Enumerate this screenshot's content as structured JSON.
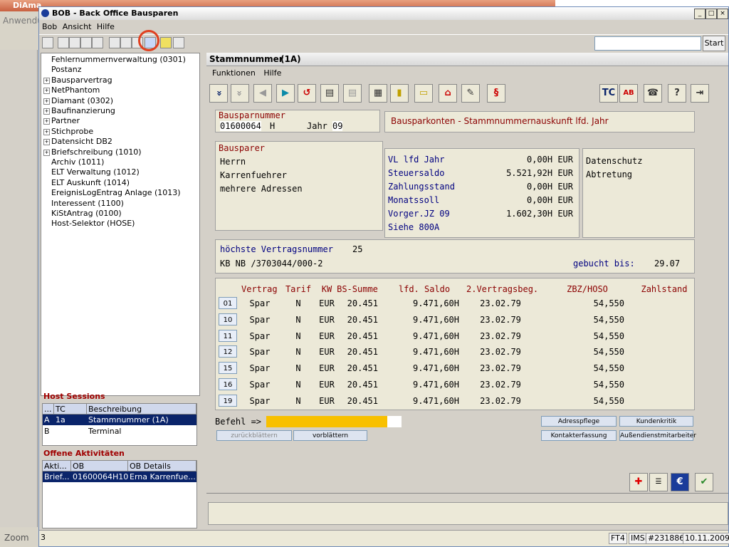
{
  "background_window": {
    "title": "DiAma",
    "menu_label": "Anwendu",
    "zoom_label": "Zoom"
  },
  "window": {
    "title": "BOB - Back Office Bausparen",
    "menu": [
      "Bob",
      "Ansicht",
      "Hilfe"
    ],
    "start_button": "Start",
    "search_value": ""
  },
  "tree": {
    "items": [
      {
        "label": "Fehlernummernverwaltung (0301)",
        "expandable": false
      },
      {
        "label": "Postanz",
        "expandable": false
      },
      {
        "label": "Bausparvertrag",
        "expandable": true
      },
      {
        "label": "NetPhantom",
        "expandable": true
      },
      {
        "label": "Diamant (0302)",
        "expandable": true
      },
      {
        "label": "Baufinanzierung",
        "expandable": true
      },
      {
        "label": "Partner",
        "expandable": true
      },
      {
        "label": "Stichprobe",
        "expandable": true
      },
      {
        "label": "Datensicht DB2",
        "expandable": true
      },
      {
        "label": "Briefschreibung (1010)",
        "expandable": true
      },
      {
        "label": "Archiv (1011)",
        "expandable": false
      },
      {
        "label": "ELT Verwaltung (1012)",
        "expandable": false
      },
      {
        "label": "ELT Auskunft (1014)",
        "expandable": false
      },
      {
        "label": "EreignisLogEntrag Anlage (1013)",
        "expandable": false
      },
      {
        "label": "Interessent (1100)",
        "expandable": false
      },
      {
        "label": "KiStAntrag (0100)",
        "expandable": false
      },
      {
        "label": "Host-Selektor (HOSE)",
        "expandable": false
      }
    ]
  },
  "host_sessions": {
    "title": "Host Sessions",
    "headers": [
      "...",
      "TC",
      "Beschreibung"
    ],
    "rows": [
      {
        "c0": "A",
        "c1": "1a",
        "c2": "Stammnummer     (1A)",
        "selected": true
      },
      {
        "c0": "B",
        "c1": "",
        "c2": "Terminal",
        "selected": false
      }
    ]
  },
  "open_activities": {
    "title": "Offene Aktivitäten",
    "headers": [
      "Akti...",
      "OB",
      "OB Details"
    ],
    "rows": [
      {
        "c0": "Brief...",
        "c1": "01600064H10",
        "c2": "Erna Karrenfue...",
        "selected": true
      }
    ]
  },
  "panel": {
    "title": "Stammnummer",
    "code": "(1A)",
    "menu": [
      "Funktionen",
      "Hilfe"
    ],
    "icons": [
      "double-chevron-down-icon",
      "double-chevron-up-icon",
      "arrow-left-icon",
      "arrow-right-icon",
      "undo-icon",
      "book-icon",
      "book-gray-icon",
      "phone-file-icon",
      "card-icon",
      "folder-icon",
      "house-icon",
      "document-edit-icon",
      "paragraph-icon",
      "tc-icon",
      "ab-icon",
      "telephone-icon",
      "help-icon",
      "exit-icon"
    ],
    "tc_label": "TC",
    "ab_label": "AB",
    "paragraph_label": "§",
    "help_label": "?"
  },
  "header_group": {
    "bausparnummer_label": "Bausparnummer",
    "bausparnummer": "01600064",
    "suffix": "H",
    "jahr_label": "Jahr",
    "jahr": "09",
    "heading": "Bausparkonten - Stammnummernauskunft lfd. Jahr"
  },
  "bausparer": {
    "label": "Bausparer",
    "lines": [
      "Herrn",
      "Karrenfuehrer",
      "mehrere Adressen"
    ]
  },
  "values": [
    {
      "label": "VL lfd Jahr",
      "value": "0,00H EUR"
    },
    {
      "label": "Steuersaldo",
      "value": "5.521,92H EUR"
    },
    {
      "label": "Zahlungsstand",
      "value": "0,00H EUR"
    },
    {
      "label": "Monatssoll",
      "value": "0,00H EUR"
    },
    {
      "label": "Vorger.JZ 09",
      "value": "1.602,30H EUR"
    },
    {
      "label": "Siehe 800A",
      "value": ""
    }
  ],
  "flags": [
    "Datenschutz",
    "Abtretung"
  ],
  "contract_info": {
    "label": "höchste Vertragsnummer",
    "value": "25",
    "kb_line": "KB NB /3703044/000-2",
    "gebucht_label": "gebucht bis:",
    "gebucht_value": "29.07"
  },
  "table": {
    "headers": [
      "Vertrag",
      "Tarif",
      "KW",
      "BS-Summe",
      "lfd. Saldo",
      "2.Vertragsbeg.",
      "ZBZ/HOSO",
      "Zahlstand"
    ],
    "rows": [
      {
        "nr": "01",
        "vertrag": "Spar",
        "tarif": "N",
        "kw": "EUR",
        "bs": "20.451",
        "saldo": "9.471,60H",
        "beg": "23.02.79",
        "zbz": "54,550",
        "zahl": ""
      },
      {
        "nr": "10",
        "vertrag": "Spar",
        "tarif": "N",
        "kw": "EUR",
        "bs": "20.451",
        "saldo": "9.471,60H",
        "beg": "23.02.79",
        "zbz": "54,550",
        "zahl": ""
      },
      {
        "nr": "11",
        "vertrag": "Spar",
        "tarif": "N",
        "kw": "EUR",
        "bs": "20.451",
        "saldo": "9.471,60H",
        "beg": "23.02.79",
        "zbz": "54,550",
        "zahl": ""
      },
      {
        "nr": "12",
        "vertrag": "Spar",
        "tarif": "N",
        "kw": "EUR",
        "bs": "20.451",
        "saldo": "9.471,60H",
        "beg": "23.02.79",
        "zbz": "54,550",
        "zahl": ""
      },
      {
        "nr": "15",
        "vertrag": "Spar",
        "tarif": "N",
        "kw": "EUR",
        "bs": "20.451",
        "saldo": "9.471,60H",
        "beg": "23.02.79",
        "zbz": "54,550",
        "zahl": ""
      },
      {
        "nr": "16",
        "vertrag": "Spar",
        "tarif": "N",
        "kw": "EUR",
        "bs": "20.451",
        "saldo": "9.471,60H",
        "beg": "23.02.79",
        "zbz": "54,550",
        "zahl": ""
      },
      {
        "nr": "19",
        "vertrag": "Spar",
        "tarif": "N",
        "kw": "EUR",
        "bs": "20.451",
        "saldo": "9.471,60H",
        "beg": "23.02.79",
        "zbz": "54,550",
        "zahl": ""
      }
    ]
  },
  "command": {
    "label": "Befehl =>",
    "value": "",
    "back_button": "zurückblättern",
    "forward_button": "vorblättern",
    "buttons": [
      "Adresspflege",
      "Kundenkritik",
      "Kontakterfassung",
      "Außendienstmitarbeiter"
    ]
  },
  "bottom_icons": [
    "swiss-cross-icon",
    "form-icon",
    "euro-icon",
    "checkmark-icon"
  ],
  "euro_symbol": "€",
  "check_symbol": "✔",
  "status": {
    "left": "3",
    "mode": "FT4",
    "imsi": "IMSI",
    "id": "#231886",
    "date": "10.11.2009"
  },
  "colors": {
    "accent_blue": "#0a246a",
    "label_red": "#8b0000",
    "value_blue": "#000080",
    "command_yellow": "#f8c000"
  }
}
